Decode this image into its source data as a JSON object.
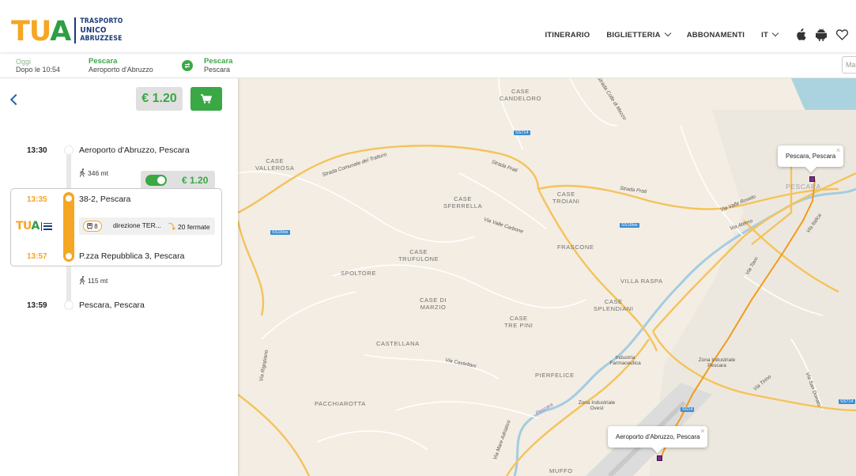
{
  "header": {
    "logo_word_a": "TU",
    "logo_word_b": "A",
    "logo_line1": "TRASPORTO",
    "logo_line2": "UNICO",
    "logo_line3": "ABRUZZESE",
    "nav": [
      {
        "label": "ITINERARIO",
        "dropdown": false
      },
      {
        "label": "BIGLIETTERIA",
        "dropdown": true
      },
      {
        "label": "ABBONAMENTI",
        "dropdown": false
      },
      {
        "label": "IT",
        "dropdown": true
      }
    ],
    "icons": [
      "apple-icon",
      "android-icon",
      "heart-icon"
    ]
  },
  "tripbar": {
    "when_label": "Oggi",
    "when_value": "Dopo le 10:54",
    "from_city": "Pescara",
    "from_place": "Aeroporto d'Abruzzo",
    "to_city": "Pescara",
    "to_place": "Pescara",
    "right_input_placeholder": "Ma"
  },
  "panel": {
    "total_price": "€ 1.20",
    "steps": [
      {
        "time": "13:30",
        "stop": "Aeroporto d'Abruzzo, Pescara"
      },
      {
        "walk": "346 mt"
      },
      {
        "time": "13:35",
        "stop": "38-2, Pescara"
      },
      {
        "time": "13:57",
        "stop": "P.zza Repubblica 3, Pescara"
      },
      {
        "walk": "115 mt"
      },
      {
        "time": "13:59",
        "stop": "Pescara, Pescara"
      }
    ],
    "toggle_price": "€ 1.20",
    "toggle_on": true,
    "leg": {
      "line": "8",
      "direction": "direzione TER...",
      "stops": "20 fermate"
    }
  },
  "map": {
    "place_labels": [
      "CASE\nCANDELORO",
      "CASE\nVALLEROSA",
      "CASE\nSFERRELLA",
      "CASE\nTROIANI",
      "FRASCONE",
      "CASE\nTRUFULONE",
      "SPOLTORE",
      "CASE DI\nMARZIO",
      "CASE\nTRE PINI",
      "VILLA RASPA",
      "CASE\nSPLENDIANI",
      "CASTELLANA",
      "PIERFELICE",
      "PACCHIAROTTA",
      "MUFFO",
      "PESCARA"
    ],
    "street_labels": [
      "Strada Comunale del Tratturo",
      "Strada Prati",
      "Strada Prati",
      "Via Valle Carbone",
      "Via Castellani",
      "Via Valle Roveto",
      "Via Aterno",
      "Via Tavo",
      "Via Mare Adriatico",
      "Via Tirino",
      "Via San Donato",
      "Strada Colle di Mezzo",
      "Via Italica",
      "Via Rigopiano",
      "Pescara"
    ],
    "area_labels": [
      "Industria Farmaceutica",
      "Zona Industriale Pescara",
      "Zona Industriale Ovest"
    ],
    "shields": [
      "SS714",
      "SS16bis",
      "SS16bis",
      "SS14",
      "SS714"
    ],
    "popups": [
      "Pescara, Pescara",
      "Aeroporto d'Abruzzo, Pescara"
    ]
  }
}
